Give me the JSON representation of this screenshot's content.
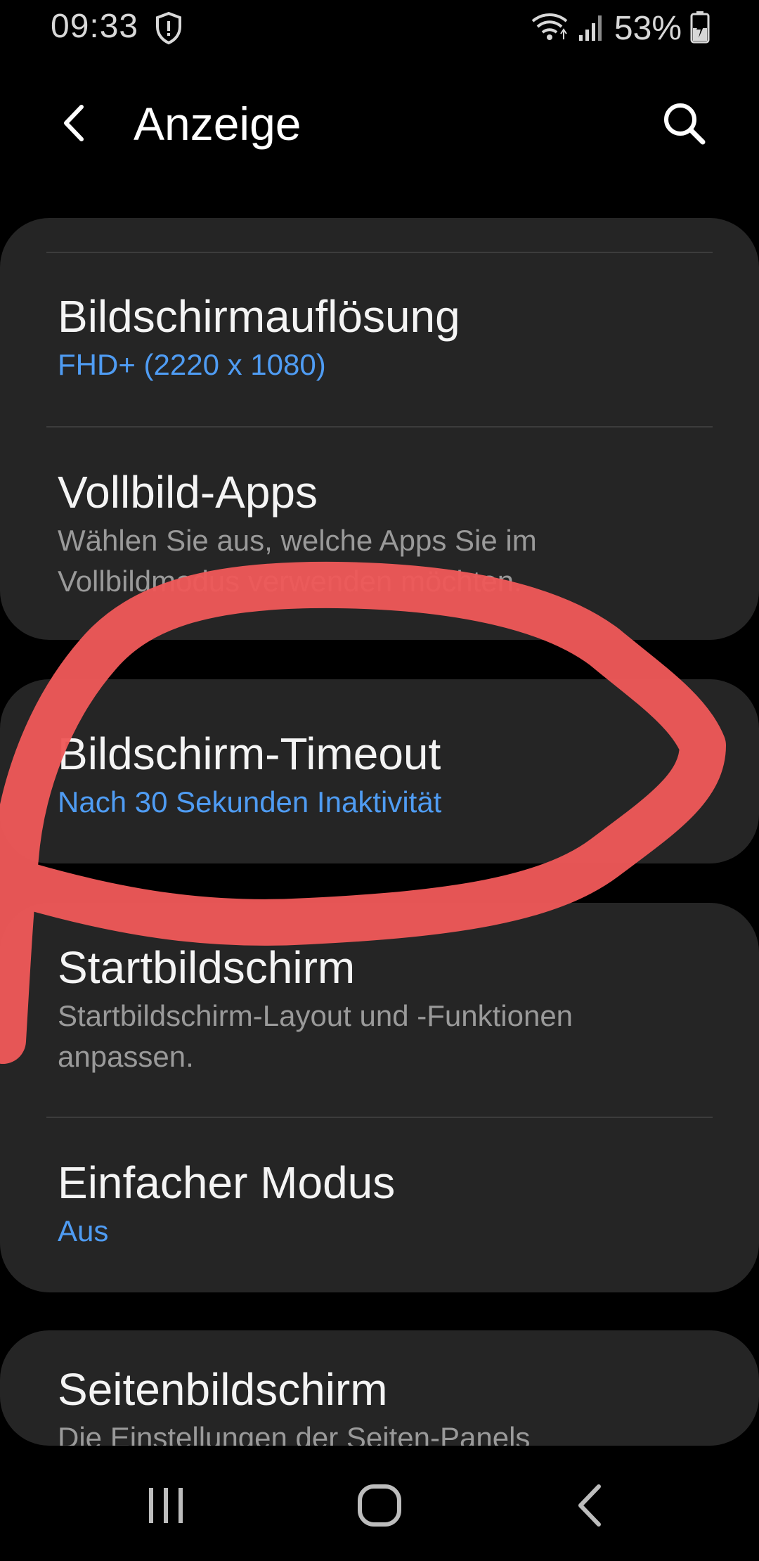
{
  "status_bar": {
    "time": "09:33",
    "battery_percent": "53%",
    "icons": [
      "shield-icon",
      "wifi-icon",
      "signal-icon",
      "battery-charging-icon"
    ]
  },
  "app_bar": {
    "title": "Anzeige",
    "back_icon": "chevron-left-icon",
    "search_icon": "search-icon"
  },
  "settings": {
    "group1": {
      "items": [
        {
          "title": "Bildschirmauflösung",
          "subtitle": "FHD+ (2220 x 1080)"
        },
        {
          "title": "Vollbild-Apps",
          "subtitle": "Wählen Sie aus, welche Apps Sie im Vollbildmodus verwenden möchten."
        }
      ]
    },
    "group2": {
      "items": [
        {
          "title": "Bildschirm-Timeout",
          "subtitle": "Nach 30 Sekunden Inaktivität"
        }
      ]
    },
    "group3": {
      "items": [
        {
          "title": "Startbildschirm",
          "subtitle": "Startbildschirm-Layout und -Funktionen anpassen."
        },
        {
          "title": "Einfacher Modus",
          "subtitle": "Aus"
        }
      ]
    },
    "group4": {
      "items": [
        {
          "title": "Seitenbildschirm",
          "subtitle": "Die Einstellungen der Seiten-Panels"
        }
      ]
    }
  },
  "nav_bar": {
    "icons": [
      "recent-apps-icon",
      "home-icon",
      "back-icon"
    ]
  },
  "colors": {
    "background": "#000000",
    "card": "#252525",
    "accent_blue": "#4f9cf3",
    "annotation_red": "#ee5858",
    "secondary_text": "#9a9a9a"
  }
}
